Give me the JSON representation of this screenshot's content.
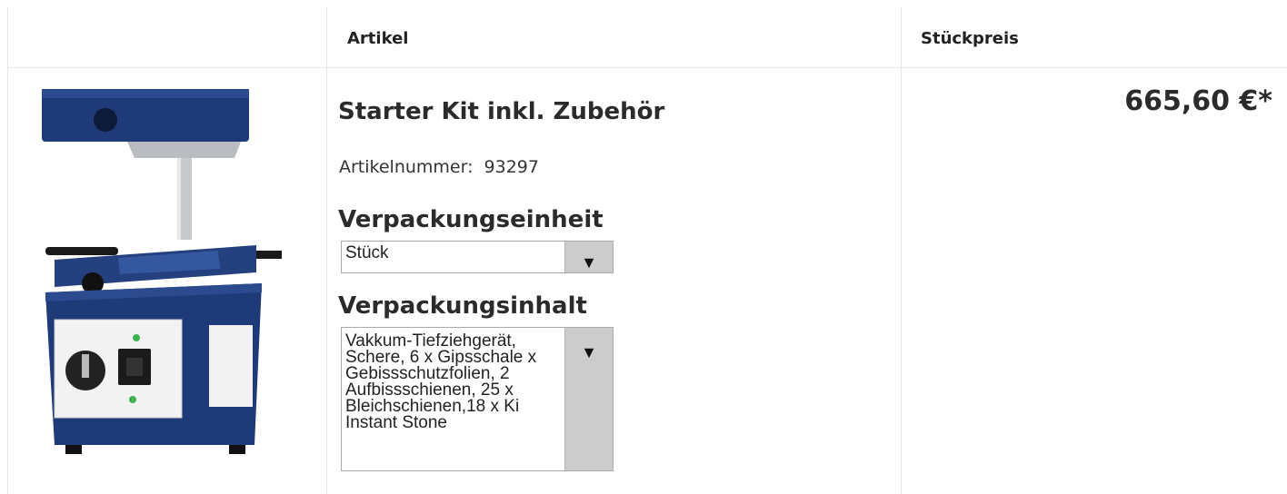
{
  "table": {
    "headers": {
      "article": "Artikel",
      "unit_price": "Stückpreis"
    }
  },
  "product": {
    "image_alt": "Vakuum-Tiefziehgerät",
    "title": "Starter Kit inkl. Zubehör",
    "article_number_label": "Artikelnummer:",
    "article_number": "93297",
    "packaging_unit_heading": "Verpackungseinheit",
    "packaging_unit_selected": "Stück",
    "packaging_content_heading": "Verpackungsinhalt",
    "packaging_content_selected": "Vakkum-Tiefziehgerät, Schere, 6 x Gipsschale x Gebissschutzfolien, 2 Aufbissschienen, 25 x Bleichschienen,18 x Ki Instant Stone",
    "price": "665,60 €*"
  },
  "icons": {
    "dropdown_arrow": "triangle-down"
  },
  "colors": {
    "device_blue": "#1f3a78",
    "border": "#e6e6e6",
    "select_button": "#cccccc"
  }
}
